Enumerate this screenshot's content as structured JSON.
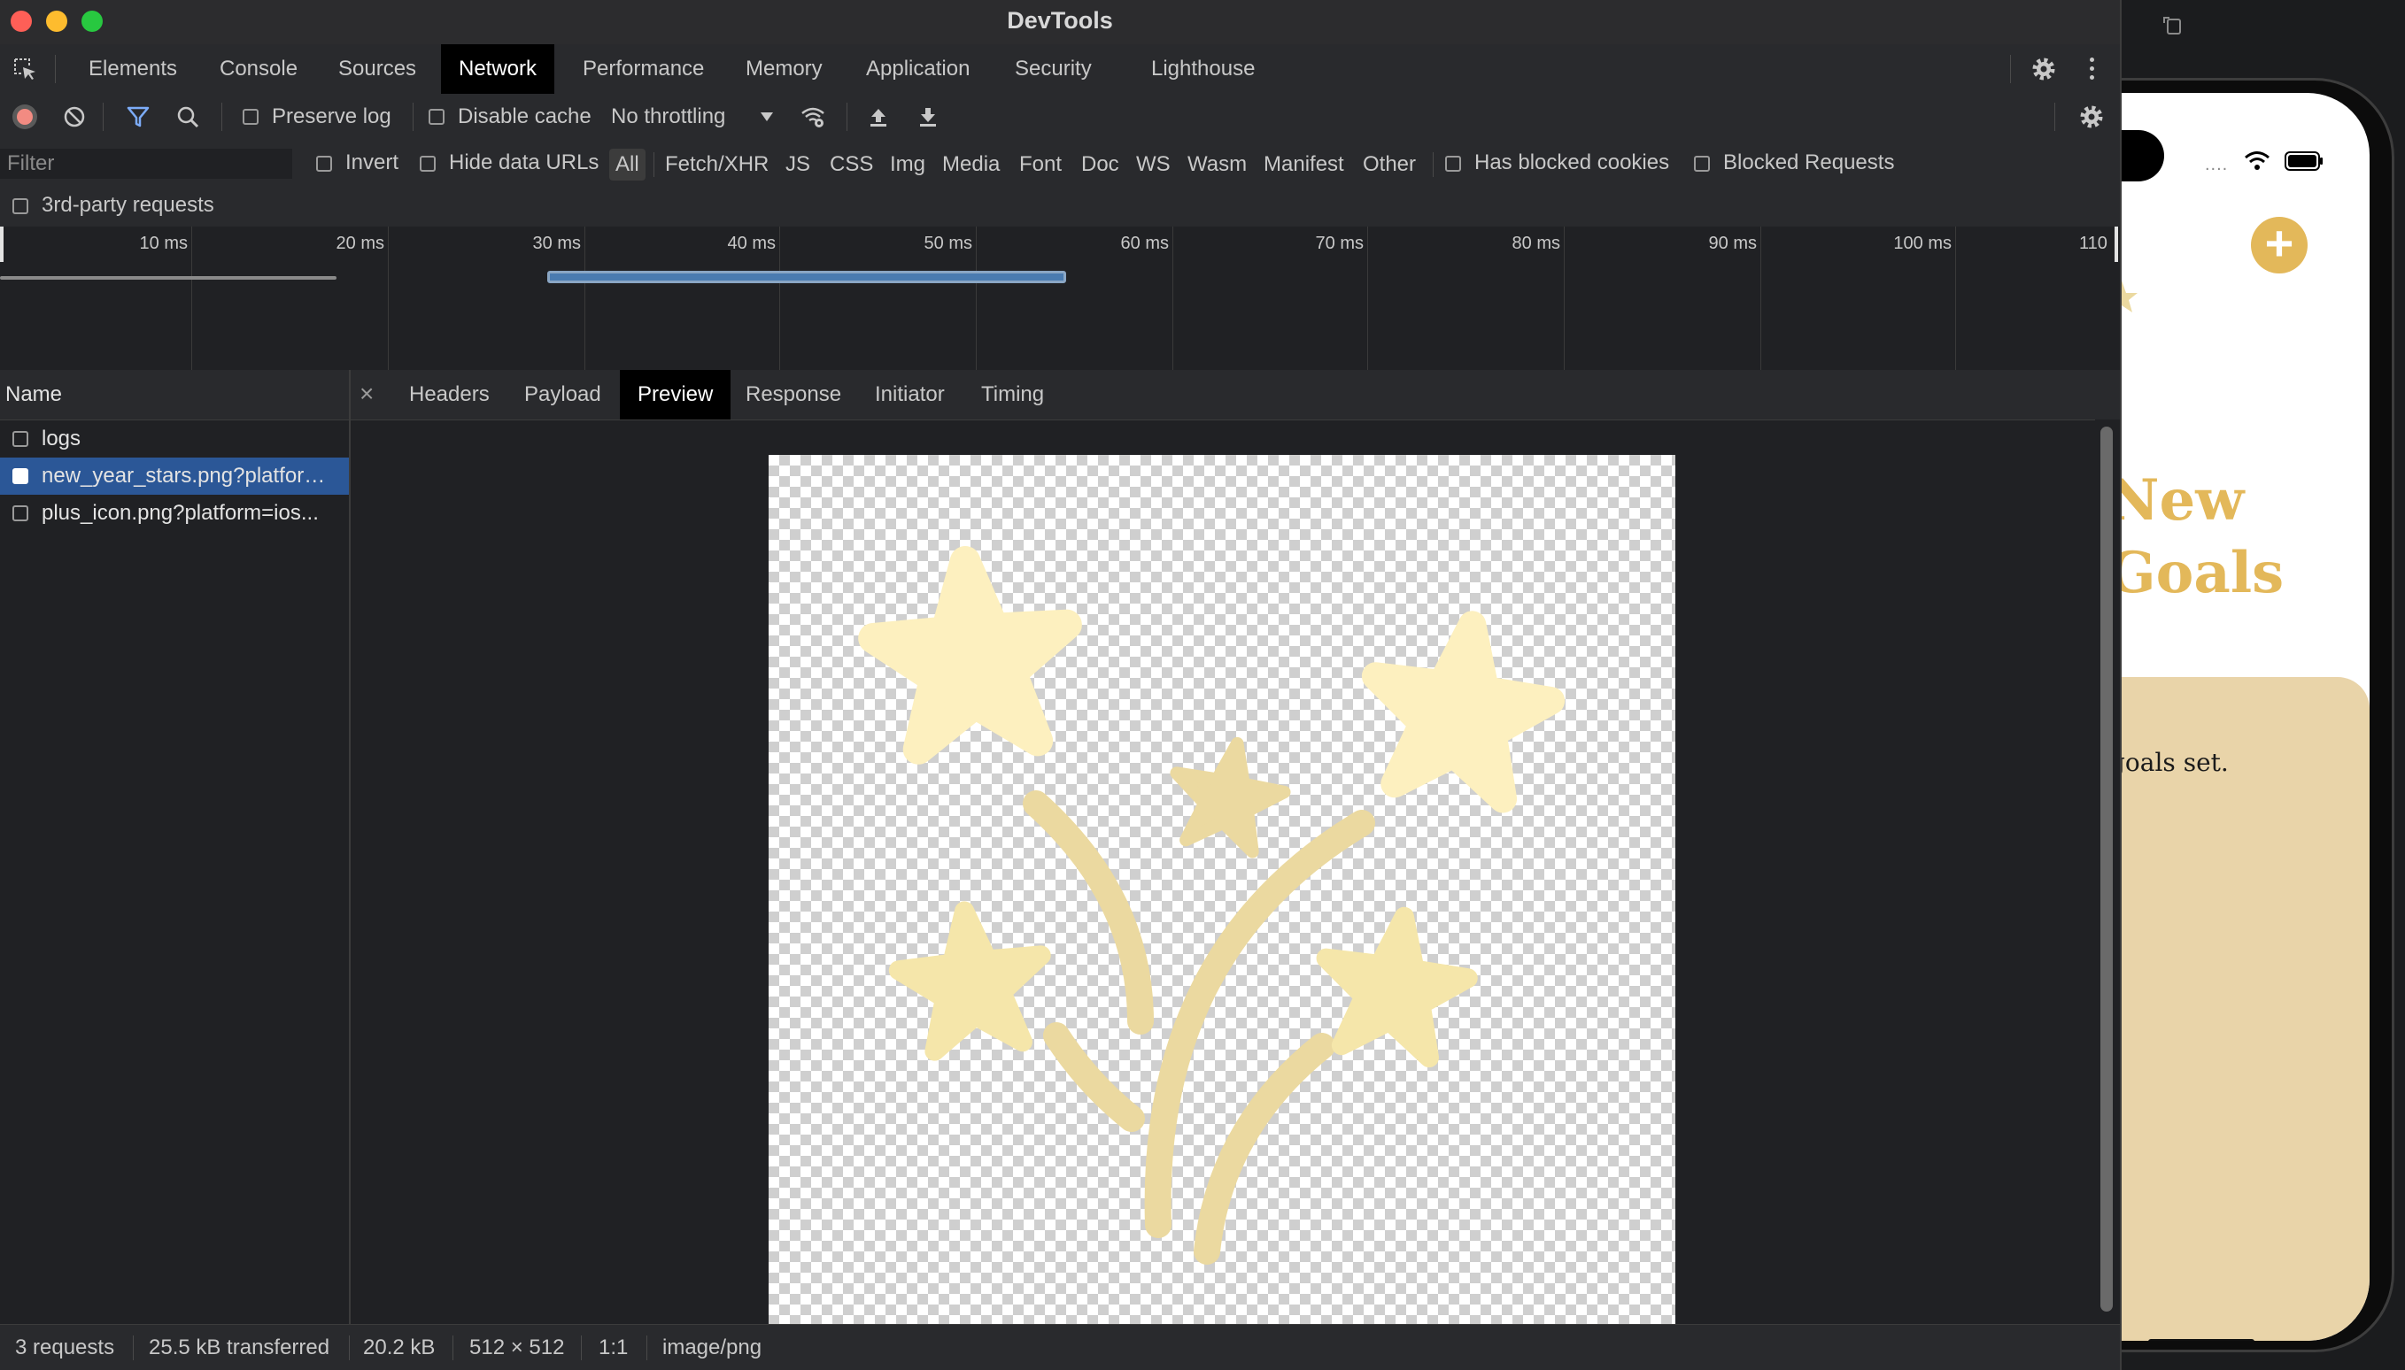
{
  "window": {
    "title": "DevTools"
  },
  "main_tabs": [
    "Elements",
    "Console",
    "Sources",
    "Network",
    "Performance",
    "Memory",
    "Application",
    "Security",
    "Lighthouse"
  ],
  "active_main_tab": "Network",
  "toolbar": {
    "preserve_log": "Preserve log",
    "disable_cache": "Disable cache",
    "throttling": "No throttling"
  },
  "filter": {
    "placeholder": "Filter",
    "invert": "Invert",
    "hide_data_urls": "Hide data URLs",
    "types": [
      "All",
      "Fetch/XHR",
      "JS",
      "CSS",
      "Img",
      "Media",
      "Font",
      "Doc",
      "WS",
      "Wasm",
      "Manifest",
      "Other"
    ],
    "active_type": "All",
    "has_blocked_cookies": "Has blocked cookies",
    "blocked_requests": "Blocked Requests",
    "third_party": "3rd-party requests"
  },
  "overview": {
    "ticks": [
      "10 ms",
      "20 ms",
      "30 ms",
      "40 ms",
      "50 ms",
      "60 ms",
      "70 ms",
      "80 ms",
      "90 ms",
      "100 ms",
      "110"
    ]
  },
  "request_list": {
    "header": "Name",
    "rows": [
      {
        "name": "logs",
        "selected": false
      },
      {
        "name": "new_year_stars.png?platform=ios...",
        "selected": true
      },
      {
        "name": "plus_icon.png?platform=ios...",
        "selected": false
      }
    ]
  },
  "detail": {
    "close_symbol": "×",
    "tabs": [
      "Headers",
      "Payload",
      "Preview",
      "Response",
      "Initiator",
      "Timing"
    ],
    "active_tab": "Preview",
    "preview_image": "new-year-stars-image"
  },
  "status": {
    "requests": "3 requests",
    "transferred": "25.5 kB transferred",
    "size": "20.2 kB",
    "dimensions": "512 × 512",
    "ratio": "1:1",
    "mime": "image/png"
  },
  "simulator": {
    "plus_label": "+",
    "title_line1": "New",
    "title_line2": "Goals",
    "card_text": "goals set.",
    "dots": "....",
    "accent_color": "#e3b85a",
    "card_color": "#e9d4a9"
  },
  "colors": {
    "selected_row": "#2b5797",
    "record_button": "#f28b82",
    "star_light": "#fdf0bf",
    "star_dark": "#ebd9a0"
  }
}
